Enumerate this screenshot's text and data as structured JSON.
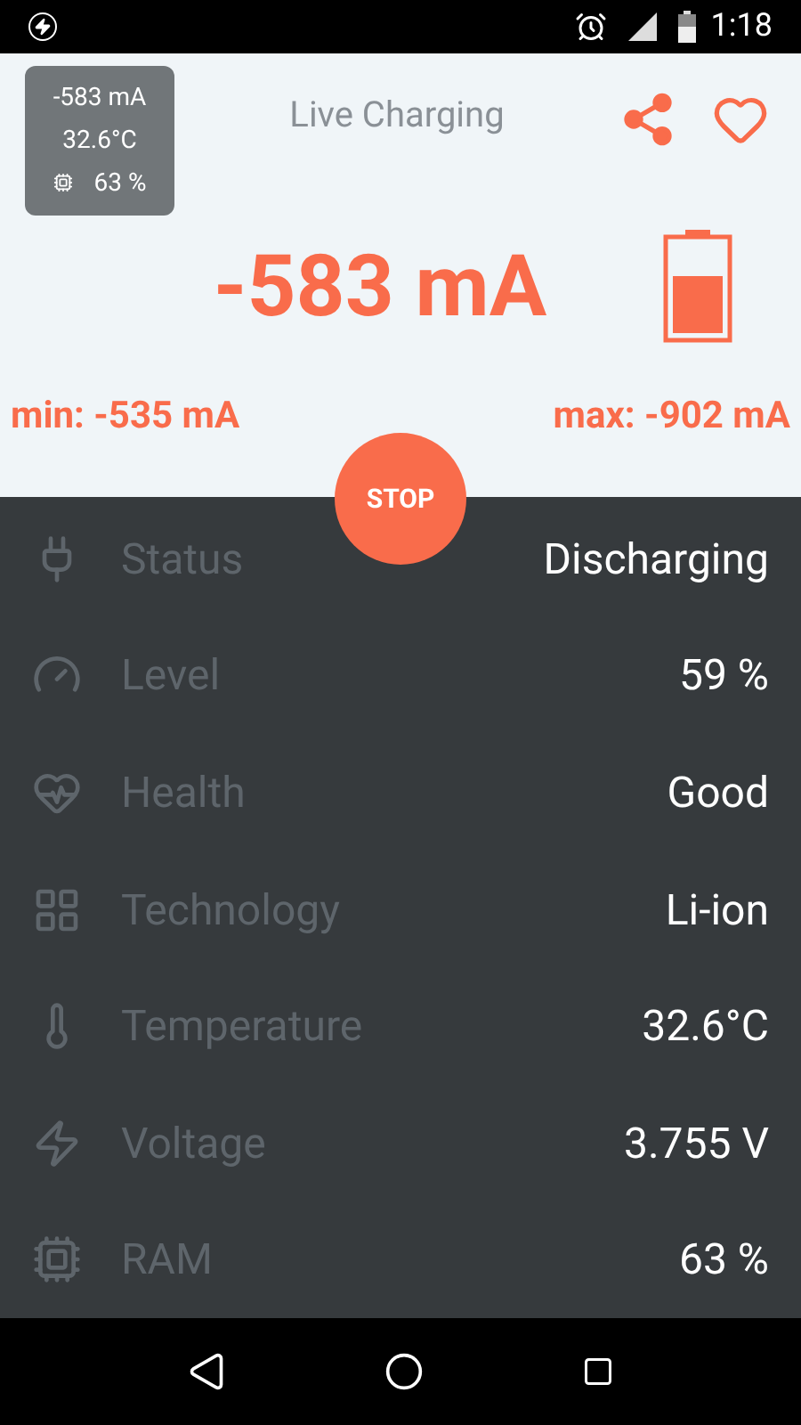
{
  "status_bar": {
    "time": "1:18"
  },
  "widget": {
    "current": "-583 mA",
    "temperature": "32.6°C",
    "ram": "63 %"
  },
  "header": {
    "title": "Live Charging"
  },
  "reading": {
    "current": "-583 mA",
    "min": "min: -535 mA",
    "max": "max: -902 mA"
  },
  "stop_button": {
    "label": "STOP"
  },
  "rows": [
    {
      "kind": "status",
      "label": "Status",
      "value": "Discharging"
    },
    {
      "kind": "level",
      "label": "Level",
      "value": "59 %"
    },
    {
      "kind": "health",
      "label": "Health",
      "value": "Good"
    },
    {
      "kind": "technology",
      "label": "Technology",
      "value": "Li-ion"
    },
    {
      "kind": "temperature",
      "label": "Temperature",
      "value": "32.6°C"
    },
    {
      "kind": "voltage",
      "label": "Voltage",
      "value": "3.755 V"
    },
    {
      "kind": "ram",
      "label": "RAM",
      "value": "63 %"
    }
  ]
}
